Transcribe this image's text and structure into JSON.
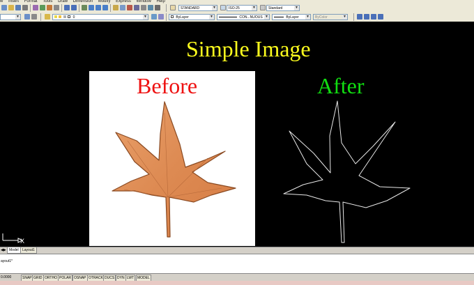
{
  "menu": [
    "w",
    "Insert",
    "Format",
    "Tools",
    "Draw",
    "Dimension",
    "Modify",
    "Express",
    "Window",
    "Help"
  ],
  "toolbar": {
    "text_style": "STANDARD",
    "dim_style": "ISO-25",
    "table_style": "Standard",
    "layer_value": "0",
    "color_control": "ByLayer",
    "linetype_control": "CON...NUOUS",
    "lineweight_control": "ByLayer",
    "plotstyle_control": "ByColor"
  },
  "canvas": {
    "title": "Simple Image",
    "before_label": "Before",
    "after_label": "After",
    "ucs_label": "X"
  },
  "tabs": [
    "Model",
    "Layout1"
  ],
  "command_line": {
    "history": "ayout1*"
  },
  "status": {
    "coords": "0.0000",
    "buttons": [
      "SNAP",
      "GRID",
      "ORTHO",
      "POLAR",
      "OSNAP",
      "OTRACK",
      "DUCS",
      "DYN",
      "LWT",
      "MODEL"
    ]
  },
  "colors": {
    "canvas_bg": "#000000",
    "title": "#ffff1e",
    "before": "#ee1111",
    "after": "#11dd11",
    "leaf": "#e2925a"
  }
}
